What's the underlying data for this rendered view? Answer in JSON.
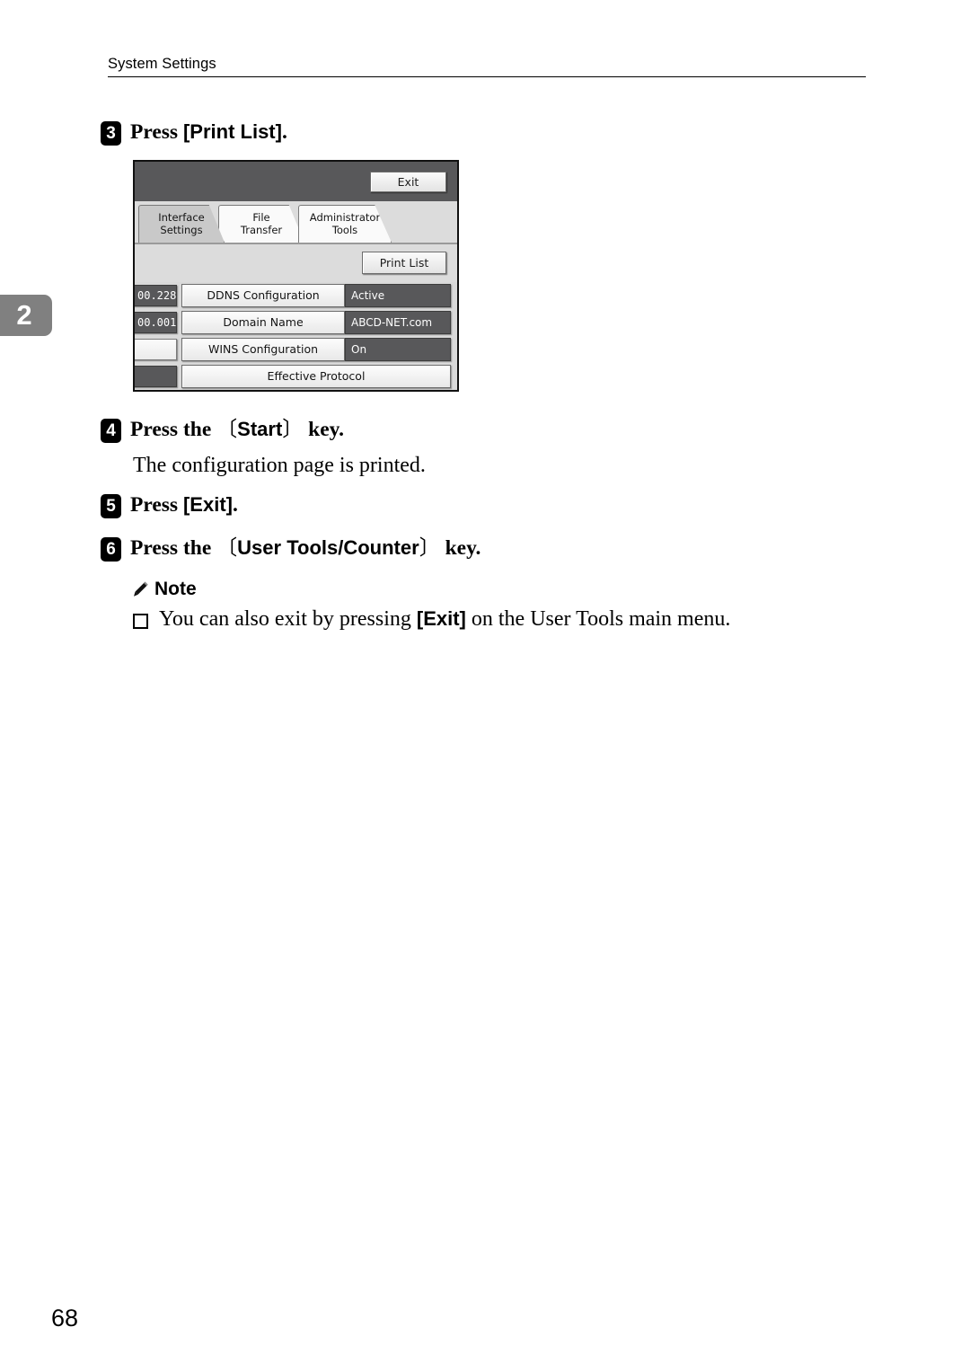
{
  "chapter_marker": "2",
  "running_header": "System Settings",
  "page_number": "68",
  "steps": [
    {
      "number": "3",
      "prefix": "Press ",
      "key": "[Print List]",
      "key_style": "soft",
      "suffix": "."
    },
    {
      "number": "4",
      "prefix": "Press the ",
      "key": "Start",
      "key_style": "hard",
      "suffix": " key."
    },
    {
      "number": "5",
      "prefix": "Press ",
      "key": "[Exit]",
      "key_style": "soft",
      "suffix": "."
    },
    {
      "number": "6",
      "prefix": "Press the ",
      "key": "User Tools/Counter",
      "key_style": "hard",
      "suffix": " key."
    }
  ],
  "body_text": "The configuration page is printed.",
  "note": {
    "icon": "pencil-icon",
    "label": "Note",
    "bullet_icon": "hollow-square-bullet",
    "item_before": "You can also exit by pressing ",
    "item_key": "[Exit]",
    "item_after": " on the User Tools main menu."
  },
  "lcd": {
    "exit_button": "Exit",
    "print_list_button": "Print List",
    "tabs": [
      {
        "line1": "Interface",
        "line2": "Settings",
        "active": true
      },
      {
        "line1": "File",
        "line2": "Transfer",
        "active": false
      },
      {
        "line1": "Administrator",
        "line2": "Tools",
        "active": false
      }
    ],
    "rows": [
      {
        "left_chip": "00.228",
        "left_chip_kind": "dark",
        "label": "DDNS Configuration",
        "value": "Active",
        "label_width": "split"
      },
      {
        "left_chip": "00.001",
        "left_chip_kind": "dark",
        "label": "Domain Name",
        "value": "ABCD-NET.com",
        "label_width": "split"
      },
      {
        "left_chip": "",
        "left_chip_kind": "light",
        "label": "WINS Configuration",
        "value": "On",
        "label_width": "split"
      },
      {
        "left_chip": "",
        "left_chip_kind": "dark",
        "label": "Effective Protocol",
        "value": "",
        "label_width": "full"
      },
      {
        "left_chip": "",
        "left_chip_kind": "dark",
        "label": "",
        "value": "",
        "label_width": "split"
      }
    ]
  },
  "colors": {
    "lcd_topbar": "#58585a",
    "lcd_background": "#d9d9d9",
    "lcd_tab_active": "#c9c9c9",
    "chapter_marker_bg": "#808080",
    "step_badge_bg": "#000000",
    "text": "#000000"
  }
}
